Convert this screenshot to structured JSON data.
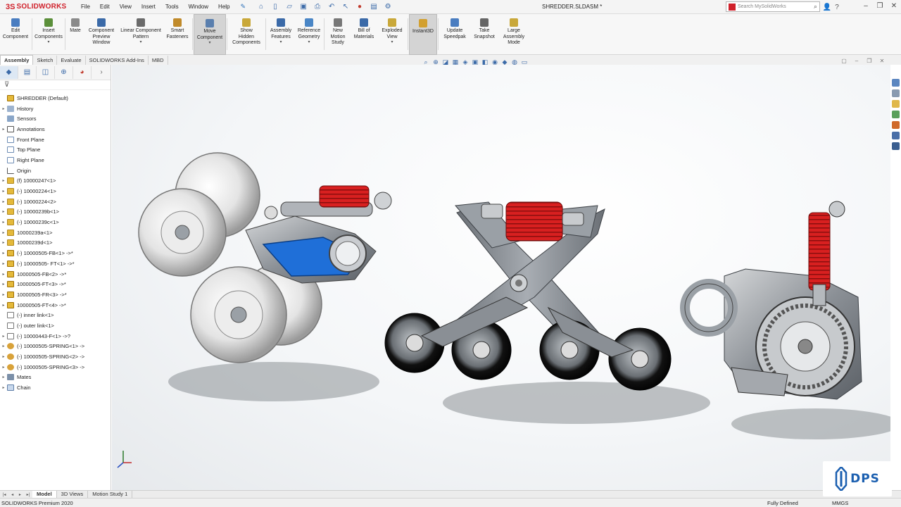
{
  "app": {
    "brand_prefix": "3S",
    "brand": "SOLIDWORKS",
    "document_title": "SHREDDER.SLDASM *",
    "edition": "SOLIDWORKS Premium 2020"
  },
  "menu": [
    "File",
    "Edit",
    "View",
    "Insert",
    "Tools",
    "Window",
    "Help"
  ],
  "search": {
    "placeholder": "Search MySolidWorks"
  },
  "ribbon": [
    {
      "label": "Edit\nComponent",
      "color": "#4a7dc0",
      "dropdown": false,
      "active": false
    },
    {
      "label": "Insert\nComponents",
      "color": "#5b8f3a",
      "dropdown": true,
      "active": false
    },
    {
      "label": "Mate",
      "color": "#8a8a8a",
      "dropdown": false,
      "active": false
    },
    {
      "label": "Component\nPreview\nWindow",
      "color": "#3b6aa8",
      "dropdown": false,
      "active": false
    },
    {
      "label": "Linear Component\nPattern",
      "color": "#6a6a6a",
      "dropdown": true,
      "active": false
    },
    {
      "label": "Smart\nFasteners",
      "color": "#c08a2a",
      "dropdown": false,
      "active": false
    },
    {
      "label": "Move\nComponent",
      "color": "#5a7fae",
      "dropdown": true,
      "active": true
    },
    {
      "label": "Show\nHidden\nComponents",
      "color": "#c9a83a",
      "dropdown": false,
      "active": false
    },
    {
      "label": "Assembly\nFeatures",
      "color": "#3b6aa8",
      "dropdown": true,
      "active": false
    },
    {
      "label": "Reference\nGeometry",
      "color": "#4a86c6",
      "dropdown": true,
      "active": false
    },
    {
      "label": "New\nMotion\nStudy",
      "color": "#777777",
      "dropdown": false,
      "active": false
    },
    {
      "label": "Bill of\nMaterials",
      "color": "#3b6aa8",
      "dropdown": false,
      "active": false
    },
    {
      "label": "Exploded\nView",
      "color": "#c9a83a",
      "dropdown": true,
      "active": false
    },
    {
      "label": "Instant3D",
      "color": "#d2a030",
      "dropdown": false,
      "active": true
    },
    {
      "label": "Update\nSpeedpak",
      "color": "#4a7dc0",
      "dropdown": false,
      "active": false
    },
    {
      "label": "Take\nSnapshot",
      "color": "#666666",
      "dropdown": false,
      "active": false
    },
    {
      "label": "Large\nAssembly\nMode",
      "color": "#c9a83a",
      "dropdown": false,
      "active": false
    }
  ],
  "cm_tabs": [
    "Assembly",
    "Sketch",
    "Evaluate",
    "SOLIDWORKS Add-Ins",
    "MBD"
  ],
  "tree": {
    "root": "SHREDDER  (Default)",
    "nodes": [
      {
        "label": "History",
        "icon": "hist",
        "exp": "▸"
      },
      {
        "label": "Sensors",
        "icon": "sensor",
        "exp": ""
      },
      {
        "label": "Annotations",
        "icon": "annot",
        "exp": "▸"
      },
      {
        "label": "Front Plane",
        "icon": "plane",
        "exp": ""
      },
      {
        "label": "Top Plane",
        "icon": "plane",
        "exp": ""
      },
      {
        "label": "Right Plane",
        "icon": "plane",
        "exp": ""
      },
      {
        "label": "Origin",
        "icon": "origin",
        "exp": ""
      },
      {
        "label": "(f) 10000247<1>",
        "icon": "part",
        "exp": "▸"
      },
      {
        "label": "(-) 10000224<1>",
        "icon": "part",
        "exp": "▸"
      },
      {
        "label": "(-) 10000224<2>",
        "icon": "part",
        "exp": "▸"
      },
      {
        "label": "(-) 10000239b<1>",
        "icon": "part",
        "exp": "▸"
      },
      {
        "label": "(-) 10000239c<1>",
        "icon": "part",
        "exp": "▸"
      },
      {
        "label": "10000239a<1>",
        "icon": "part",
        "exp": "▸"
      },
      {
        "label": "10000239d<1>",
        "icon": "part",
        "exp": "▸"
      },
      {
        "label": "(-) 10000505-FB<1> ->*",
        "icon": "asm",
        "exp": "▸"
      },
      {
        "label": "(-) 10000505- FT<1> ->*",
        "icon": "asm",
        "exp": "▸"
      },
      {
        "label": "10000505-FB<2> ->*",
        "icon": "asm",
        "exp": "▸"
      },
      {
        "label": "10000505-FT<3> ->*",
        "icon": "asm",
        "exp": "▸"
      },
      {
        "label": "10000505-FR<3> ->*",
        "icon": "asm",
        "exp": "▸"
      },
      {
        "label": "10000505-FT<4> ->*",
        "icon": "asm",
        "exp": "▸"
      },
      {
        "label": "(-) inner link<1>",
        "icon": "sketch",
        "exp": ""
      },
      {
        "label": "(-) outer link<1>",
        "icon": "sketch",
        "exp": ""
      },
      {
        "label": "(-) 10000443-F<1> ->?",
        "icon": "sketch",
        "exp": "▸"
      },
      {
        "label": "(-) 10000505-SPRING<1> ->",
        "icon": "spring",
        "exp": "▸"
      },
      {
        "label": "(-) 10000505-SPRING<2> ->",
        "icon": "spring",
        "exp": "▸"
      },
      {
        "label": "(-) 10000505-SPRING<3> ->",
        "icon": "spring",
        "exp": "▸"
      },
      {
        "label": "Mates",
        "icon": "mates",
        "exp": "▸"
      },
      {
        "label": "Chain",
        "icon": "chain",
        "exp": "▸"
      }
    ]
  },
  "bottom_tabs": [
    "Model",
    "3D Views",
    "Motion Study 1"
  ],
  "status": {
    "defined": "Fully Defined",
    "units": "MMGS"
  },
  "watermark": "DPS"
}
